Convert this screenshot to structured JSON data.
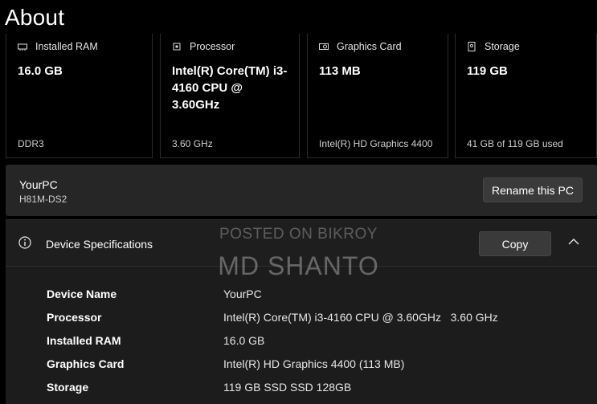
{
  "page": {
    "title": "About"
  },
  "cards": [
    {
      "icon": "ram-icon",
      "label": "Installed RAM",
      "value": "16.0 GB",
      "sub": "DDR3"
    },
    {
      "icon": "processor-icon",
      "label": "Processor",
      "value": "Intel(R) Core(TM) i3-4160 CPU @ 3.60GHz",
      "sub": "3.60 GHz"
    },
    {
      "icon": "graphics-card-icon",
      "label": "Graphics Card",
      "value": "113 MB",
      "sub": "Intel(R) HD Graphics 4400"
    },
    {
      "icon": "storage-icon",
      "label": "Storage",
      "value": "119 GB",
      "sub": "41 GB of 119 GB used"
    }
  ],
  "pc": {
    "name": "YourPC",
    "model": "H81M-DS2",
    "rename_label": "Rename this PC"
  },
  "specs": {
    "title": "Device Specifications",
    "copy_label": "Copy",
    "rows": [
      {
        "key": "Device Name",
        "value": "YourPC"
      },
      {
        "key": "Processor",
        "value": "Intel(R) Core(TM) i3-4160 CPU @ 3.60GHz   3.60 GHz"
      },
      {
        "key": "Installed RAM",
        "value": "16.0 GB"
      },
      {
        "key": "Graphics Card",
        "value": "Intel(R) HD Graphics 4400 (113 MB)"
      },
      {
        "key": "Storage",
        "value": "119 GB SSD SSD 128GB"
      }
    ]
  },
  "watermark": {
    "line1": "POSTED ON BIKROY",
    "line2": "MD SHANTO"
  }
}
